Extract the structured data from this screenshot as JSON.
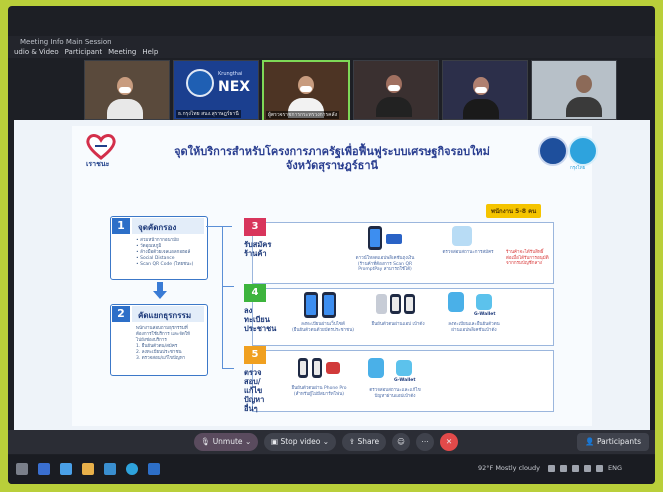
{
  "window": {
    "title": "Meeting Info   Main Session",
    "menus": [
      "udio & Video",
      "Participant",
      "Meeting",
      "Help"
    ]
  },
  "participants": [
    {
      "name": ""
    },
    {
      "name": "ธ.กรุงไทย สนง.สุราษฎร์ธานี",
      "logo_text": "NEX",
      "logo_sub": "Krungthai"
    },
    {
      "name": "ผู้ตรวจราชการกระทรวงการคลัง"
    },
    {
      "name": ""
    },
    {
      "name": ""
    },
    {
      "name": ""
    }
  ],
  "slide": {
    "left_logo_label": "เราชนะ",
    "title_line1": "จุดให้บริการสำหรับโครงการภาครัฐเพื่อฟื้นฟูระบบเศรษฐกิจรอบใหม่",
    "title_line2": "จังหวัดสุราษฎร์ธานี",
    "right_seal_label": "กรุงไทย",
    "staff_badge": "พนักงาน 5-8 คน",
    "step1": {
      "number": "1",
      "title": "จุดคัดกรอง",
      "bullets": [
        "• สวมหน้ากากอนามัย",
        "• วัดอุณหภูมิ",
        "• ล้างมือด้วยเจลแอลกอฮอล์",
        "• Social Distance",
        "• Scan QR Code (ไทยชนะ)"
      ]
    },
    "step2": {
      "number": "2",
      "title": "คัดแยกธุรกรรม",
      "bullets": [
        "พนักงานสอบถามธุรกรรมที่",
        "ต้องการใช้บริการ และจัดให้",
        "ไปยังช่องบริการ",
        "1. ยืนยันตัวตน/สมัคร",
        "2. ลงทะเบียนประชาชน",
        "3. ตรวจสอบ/แก้ไขปัญหา"
      ]
    },
    "step3": {
      "number": "3",
      "label": "รับสมัคร ร้านค้า",
      "captions": [
        "ดาวน์โหลดแอปพลิเคชันถุงเงิน",
        "(ร้านค้าที่ต้องการ Scan QR",
        "PromptPay สามารถใช้ได้)",
        "ตรวจสอบสถานะการสมัคร"
      ],
      "note": [
        "ร้านค้าจะได้รับสิทธิ์",
        "ต่อเมื่อได้รับการอนุมัติ",
        "จากกรมบัญชีกลาง"
      ]
    },
    "step4": {
      "number": "4",
      "label": "ลงทะเบียน ประชาชน",
      "captions": [
        "ลงทะเบียนผ่านเว็บไซต์",
        "(ยืนยันตัวตนด้วยบัตรประชาชน)",
        "ยืนยันตัวตนผ่านแอป เป๋าตัง",
        "ลงทะเบียนและยืนยันตัวตน",
        "ผ่านแอปพลิเคชันเป๋าตัง"
      ],
      "gwallet": "G-Wallet"
    },
    "step5": {
      "number": "5",
      "label": "ตรวจสอบ/ แก้ไขปัญหา อื่นๆ",
      "captions": [
        "ยืนยันตัวตนผ่าน Phone Pro",
        "(สำหรับผู้ไม่มีสมาร์ทโฟน)",
        "ตรวจสอบสถานะและแก้ไข",
        "ปัญหาผ่านแอปเป๋าตัง"
      ],
      "gwallet": "G-Wallet"
    }
  },
  "controls": {
    "unmute": "Unmute",
    "stop_video": "Stop video",
    "share": "Share",
    "participants": "Participants"
  },
  "taskbar": {
    "weather": "92°F  Mostly cloudy",
    "lang": "ENG"
  },
  "colors": {
    "step1": "#2d6fc8",
    "step2": "#2d6fc8",
    "step3": "#d8355c",
    "step4": "#3db43d",
    "step5": "#f0a020",
    "accent": "#2a3e90"
  }
}
